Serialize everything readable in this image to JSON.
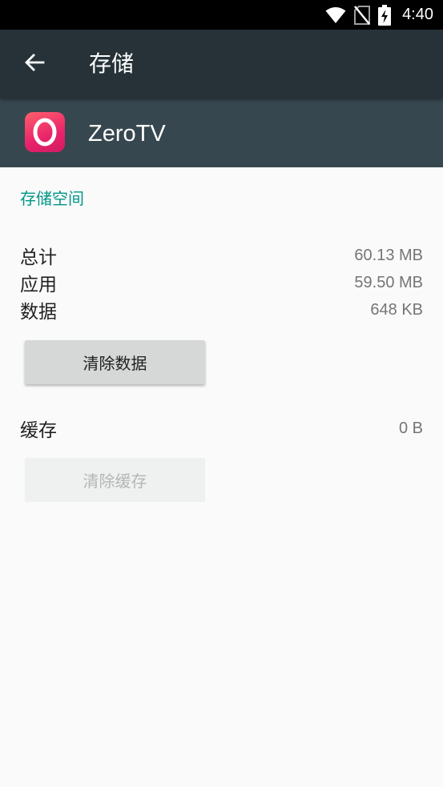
{
  "status_bar": {
    "time": "4:40",
    "icons": [
      "wifi-icon",
      "no-sim-icon",
      "battery-charging-icon"
    ]
  },
  "app_bar": {
    "back_icon": "arrow-back-icon",
    "title": "存储"
  },
  "app_header": {
    "app_icon": "zerotv-app-icon",
    "app_name": "ZeroTV"
  },
  "storage": {
    "section_title": "存储空间",
    "rows": [
      {
        "label": "总计",
        "value": "60.13 MB"
      },
      {
        "label": "应用",
        "value": "59.50 MB"
      },
      {
        "label": "数据",
        "value": "648 KB"
      }
    ],
    "clear_data_label": "清除数据"
  },
  "cache": {
    "label": "缓存",
    "value": "0 B",
    "clear_cache_label": "清除缓存"
  },
  "colors": {
    "app_bar": "#263238",
    "header": "#37474f",
    "accent": "#009688",
    "background": "#fafafa"
  }
}
